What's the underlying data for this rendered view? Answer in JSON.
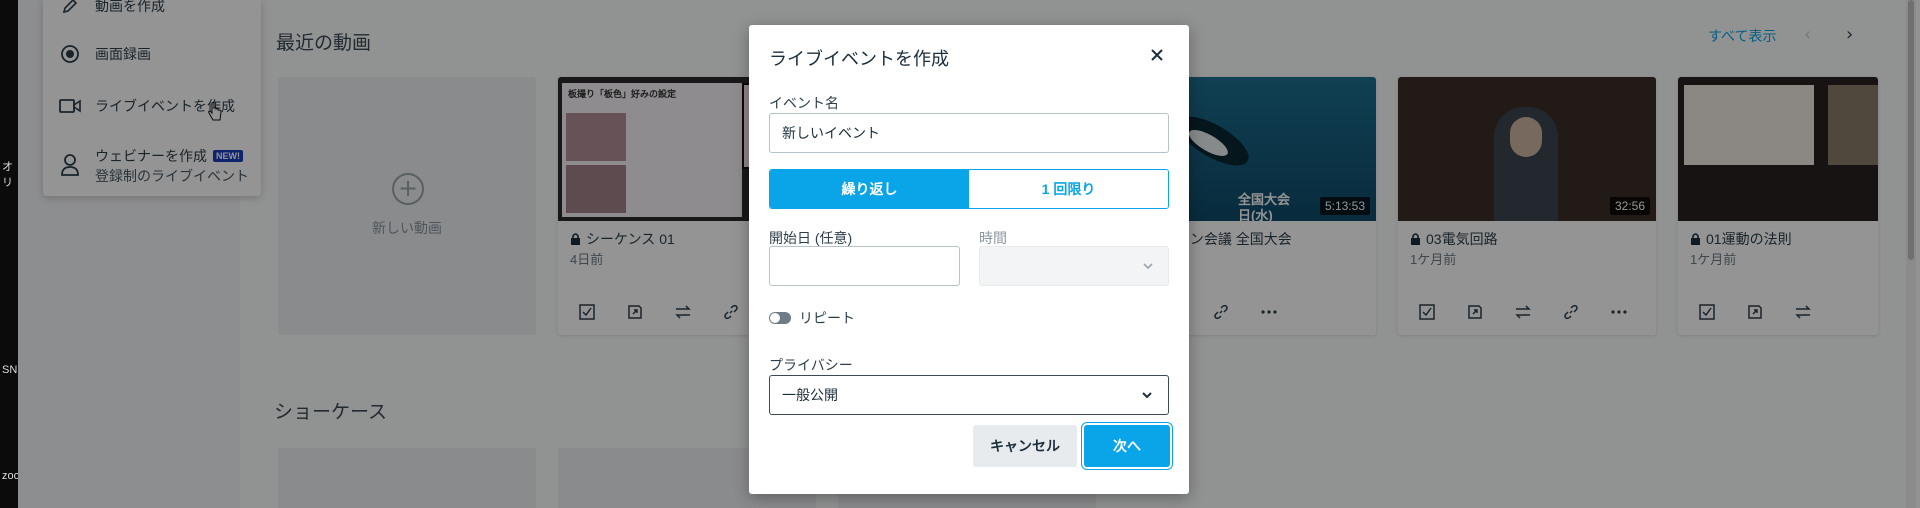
{
  "left_strip_labels": [
    "オリ",
    "SN",
    "zoo"
  ],
  "create_menu": {
    "items": [
      {
        "label": "動画を作成",
        "icon": "pencil-icon"
      },
      {
        "label": "画面録画",
        "icon": "record-icon"
      },
      {
        "label": "ライブイベントを作成",
        "icon": "camera-icon"
      },
      {
        "label": "ウェビナーを作成",
        "icon": "person-icon",
        "badge": "NEW!",
        "sub": "登録制のライブイベント"
      }
    ]
  },
  "recent": {
    "title": "最近の動画",
    "show_all": "すべて表示",
    "new_video_label": "新しい動画",
    "cards": [
      {
        "title": "シーケンス 01",
        "date": "4日前",
        "duration": ""
      },
      {
        "title": "回 ペンギン会議 全国大会",
        "date": "",
        "duration": "5:13:53"
      },
      {
        "title": "03電気回路",
        "date": "1ケ月前",
        "duration": "32:56"
      },
      {
        "title": "01運動の法則",
        "date": "1ケ月前",
        "duration": ""
      }
    ],
    "thumb_texts": {
      "card1": "板撮り「板色」好みの設定",
      "card2_a": "全国大会",
      "card2_b": "日(水)"
    }
  },
  "showcase": {
    "title": "ショーケース"
  },
  "modal": {
    "title": "ライブイベントを作成",
    "event_name_label": "イベント名",
    "event_name_value": "新しいイベント",
    "segment": {
      "active": "繰り返し",
      "inactive": "1 回限り"
    },
    "start_date_label": "開始日 (任意)",
    "time_label": "時間",
    "repeat_label": "リピート",
    "repeat_on": false,
    "privacy_label": "プライバシー",
    "privacy_value": "一般公開",
    "cancel_label": "キャンセル",
    "next_label": "次へ"
  },
  "colors": {
    "accent": "#0aa5e8",
    "badge": "#1a3cbe",
    "overlay": "rgba(0,0,0,0.42)"
  }
}
